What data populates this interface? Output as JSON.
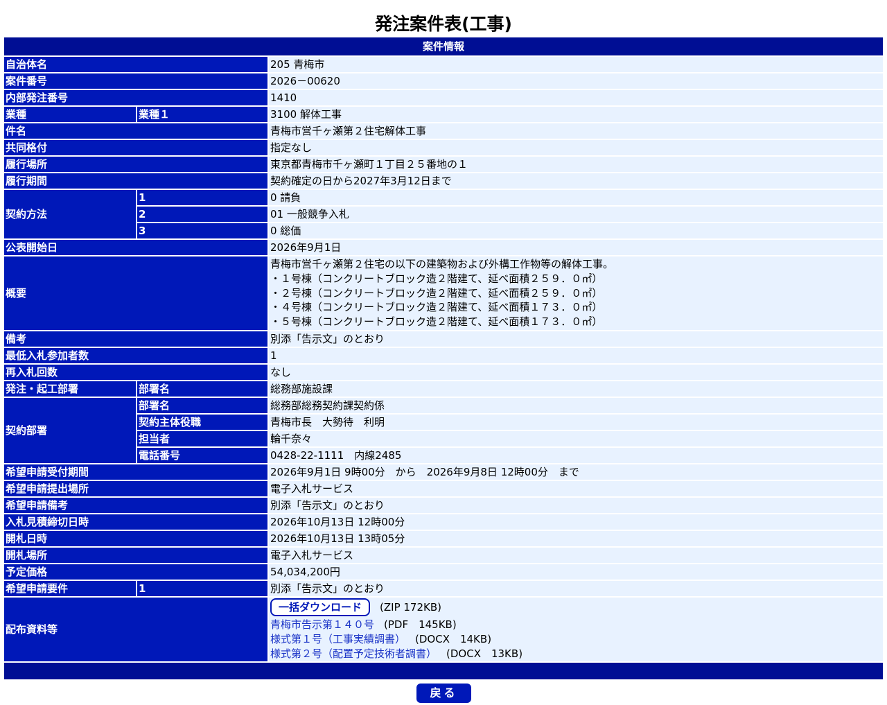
{
  "title": "発注案件表(工事)",
  "section_header": "案件情報",
  "labels": {
    "municipality": "自治体名",
    "case_number": "案件番号",
    "internal_number": "内部発注番号",
    "industry": "業種",
    "industry_sub": "業種１",
    "name": "件名",
    "joint": "共同格付",
    "location": "履行場所",
    "period": "履行期間",
    "contract_method": "契約方法",
    "contract_sub_1": "1",
    "contract_sub_2": "2",
    "contract_sub_3": "3",
    "publish_date": "公表開始日",
    "summary": "概要",
    "remarks": "備考",
    "min_bidders": "最低入札参加者数",
    "rebid_count": "再入札回数",
    "ordering_dept": "発注・起工部署",
    "dept_name": "部署名",
    "contract_dept": "契約部署",
    "contract_dept_name": "部署名",
    "contract_official": "契約主体役職",
    "person": "担当者",
    "phone": "電話番号",
    "app_period": "希望申請受付期間",
    "app_place": "希望申請提出場所",
    "app_remarks": "希望申請備考",
    "bid_deadline": "入札見積締切日時",
    "opening_datetime": "開札日時",
    "opening_place": "開札場所",
    "est_price": "予定価格",
    "app_requirements": "希望申請要件",
    "app_req_sub": "1",
    "documents": "配布資料等"
  },
  "values": {
    "municipality": "205 青梅市",
    "case_number": "2026－00620",
    "internal_number": "1410",
    "industry": "3100 解体工事",
    "name": "青梅市営千ヶ瀬第２住宅解体工事",
    "joint": "指定なし",
    "location": "東京都青梅市千ヶ瀬町１丁目２５番地の１",
    "period": "契約確定の日から2027年3月12日まで",
    "contract_1": "0 請負",
    "contract_2": "01 一般競争入札",
    "contract_3": "0 総価",
    "publish_date": "2026年9月1日",
    "summary_lines": [
      "青梅市営千ヶ瀬第２住宅の以下の建築物および外構工作物等の解体工事。",
      "・１号棟（コンクリートブロック造２階建て、延べ面積２５９．０㎡）",
      "・２号棟（コンクリートブロック造２階建て、延べ面積２５９．０㎡）",
      "・４号棟（コンクリートブロック造２階建て、延べ面積１７３．０㎡）",
      "・５号棟（コンクリートブロック造２階建て、延べ面積１７３．０㎡）"
    ],
    "remarks": "別添「告示文」のとおり",
    "min_bidders": "1",
    "rebid_count": "なし",
    "ordering_dept_name": "総務部施設課",
    "contract_dept_name": "総務部総務契約課契約係",
    "contract_official": "青梅市長　大勢待　利明",
    "person": "輪千奈々",
    "phone": "0428-22-1111　内線2485",
    "app_period": "2026年9月1日 9時00分　から　2026年9月8日 12時00分　まで",
    "app_place": "電子入札サービス",
    "app_remarks": "別添「告示文」のとおり",
    "bid_deadline": "2026年10月13日 12時00分",
    "opening_datetime": "2026年10月13日 13時05分",
    "opening_place": "電子入札サービス",
    "est_price": "54,034,200円",
    "app_requirements": "別添「告示文」のとおり"
  },
  "documents": {
    "bulk_download_label": "一括ダウンロード",
    "bulk_size": "(ZIP 172KB)",
    "files": [
      {
        "name": "青梅市告示第１４０号",
        "size": "(PDF　145KB)"
      },
      {
        "name": "様式第１号（工事実績調書）",
        "size": "(DOCX　14KB)"
      },
      {
        "name": "様式第２号（配置予定技術者調書）",
        "size": "(DOCX　13KB)"
      }
    ]
  },
  "back_button": "戻る",
  "colors": {
    "header_bg": "#000e94",
    "label_bg": "#0018b8",
    "value_bg": "#e8f2ff",
    "link": "#1a33c7"
  }
}
